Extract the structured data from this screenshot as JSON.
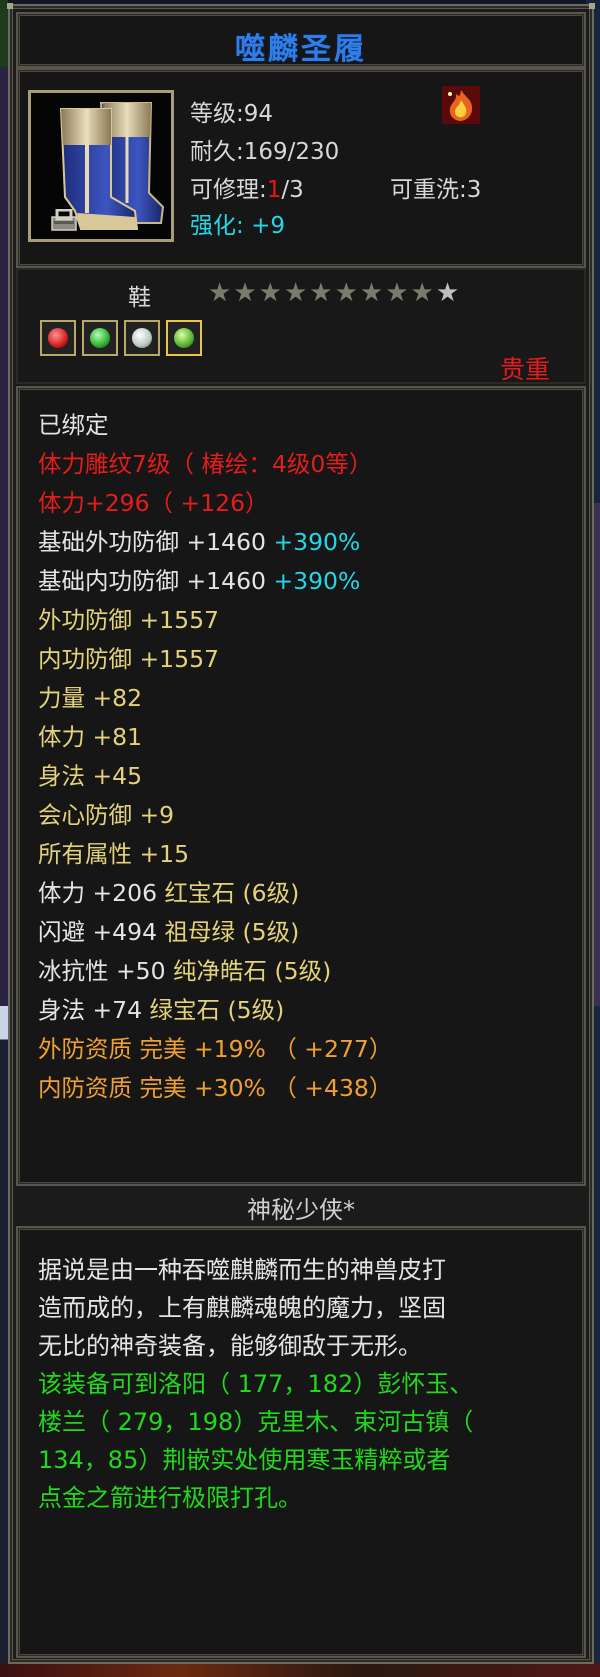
{
  "title": "噬麟圣履",
  "header": {
    "level": "等级:94",
    "durability": "耐久:169/230",
    "repair_prefix": "可修理:",
    "repair_current": "1",
    "repair_suffix": "/3",
    "rewash": "可重洗:3",
    "enhance_label": "强化:",
    "enhance_value": "+9"
  },
  "type_label": "鞋",
  "stars": {
    "filled": 9,
    "total": 10
  },
  "gems": [
    {
      "icon": "red-gem-icon",
      "color": "#d42020"
    },
    {
      "icon": "green-gem-icon",
      "color": "#30b030"
    },
    {
      "icon": "white-gem-icon",
      "color": "#b8c8c0"
    },
    {
      "icon": "jade-gem-icon",
      "color": "#58b030"
    }
  ],
  "rarity": "贵重",
  "attributes": [
    {
      "parts": [
        {
          "t": "已绑定",
          "c": "white"
        }
      ]
    },
    {
      "parts": [
        {
          "t": "体力雕纹7级（ 椿绘：4级0等）",
          "c": "red"
        }
      ]
    },
    {
      "parts": [
        {
          "t": "体力+296（ +126）",
          "c": "red"
        }
      ]
    },
    {
      "parts": [
        {
          "t": "基础外功防御 +1460 ",
          "c": "white"
        },
        {
          "t": "+390%",
          "c": "cyan"
        }
      ]
    },
    {
      "parts": [
        {
          "t": "基础内功防御 +1460 ",
          "c": "white"
        },
        {
          "t": "+390%",
          "c": "cyan"
        }
      ]
    },
    {
      "parts": [
        {
          "t": "外功防御 +1557",
          "c": "yellow"
        }
      ]
    },
    {
      "parts": [
        {
          "t": "内功防御 +1557",
          "c": "yellow"
        }
      ]
    },
    {
      "parts": [
        {
          "t": "力量 +82",
          "c": "yellow"
        }
      ]
    },
    {
      "parts": [
        {
          "t": "体力 +81",
          "c": "yellow"
        }
      ]
    },
    {
      "parts": [
        {
          "t": "身法 +45",
          "c": "yellow"
        }
      ]
    },
    {
      "parts": [
        {
          "t": "会心防御 +9",
          "c": "yellow"
        }
      ]
    },
    {
      "parts": [
        {
          "t": "所有属性 +15",
          "c": "yellow"
        }
      ]
    },
    {
      "parts": [
        {
          "t": "体力 +206 ",
          "c": "white"
        },
        {
          "t": "红宝石 (6级)",
          "c": "yellow"
        }
      ]
    },
    {
      "parts": [
        {
          "t": "闪避 +494 ",
          "c": "white"
        },
        {
          "t": "祖母绿 (5级)",
          "c": "yellow"
        }
      ]
    },
    {
      "parts": [
        {
          "t": "冰抗性 +50 ",
          "c": "white"
        },
        {
          "t": "纯净皓石 (5级)",
          "c": "yellow"
        }
      ]
    },
    {
      "parts": [
        {
          "t": "身法 +74 ",
          "c": "white"
        },
        {
          "t": "绿宝石 (5级)",
          "c": "yellow"
        }
      ]
    },
    {
      "parts": [
        {
          "t": "外防资质  完美 +19% （ +277）",
          "c": "orange"
        }
      ]
    },
    {
      "parts": [
        {
          "t": "内防资质  完美 +30% （ +438）",
          "c": "orange"
        }
      ]
    }
  ],
  "maker": "神秘少侠*",
  "description": [
    {
      "t": "据说是由一种吞噬麒麟而生的神兽皮打",
      "c": "white"
    },
    {
      "t": "造而成的，上有麒麟魂魄的魔力，坚固",
      "c": "white"
    },
    {
      "t": "无比的神奇装备，能够御敌于无形。",
      "c": "white"
    },
    {
      "t": "该装备可到洛阳（ 177，182）彭怀玉、",
      "c": "green"
    },
    {
      "t": "楼兰（ 279，198）克里木、束河古镇（",
      "c": "green"
    },
    {
      "t": "134，85）荆嵌实处使用寒玉精粹或者",
      "c": "green"
    },
    {
      "t": "点金之箭进行极限打孔。",
      "c": "green"
    }
  ],
  "colors": {
    "white": "#e4e4e4",
    "red": "#e41c1c",
    "yellow": "#e4d27a",
    "orange": "#f0a032",
    "cyan": "#22d8e8",
    "green": "#22d81c",
    "title": "#2f7de8",
    "rarity": "#e41c1c"
  }
}
